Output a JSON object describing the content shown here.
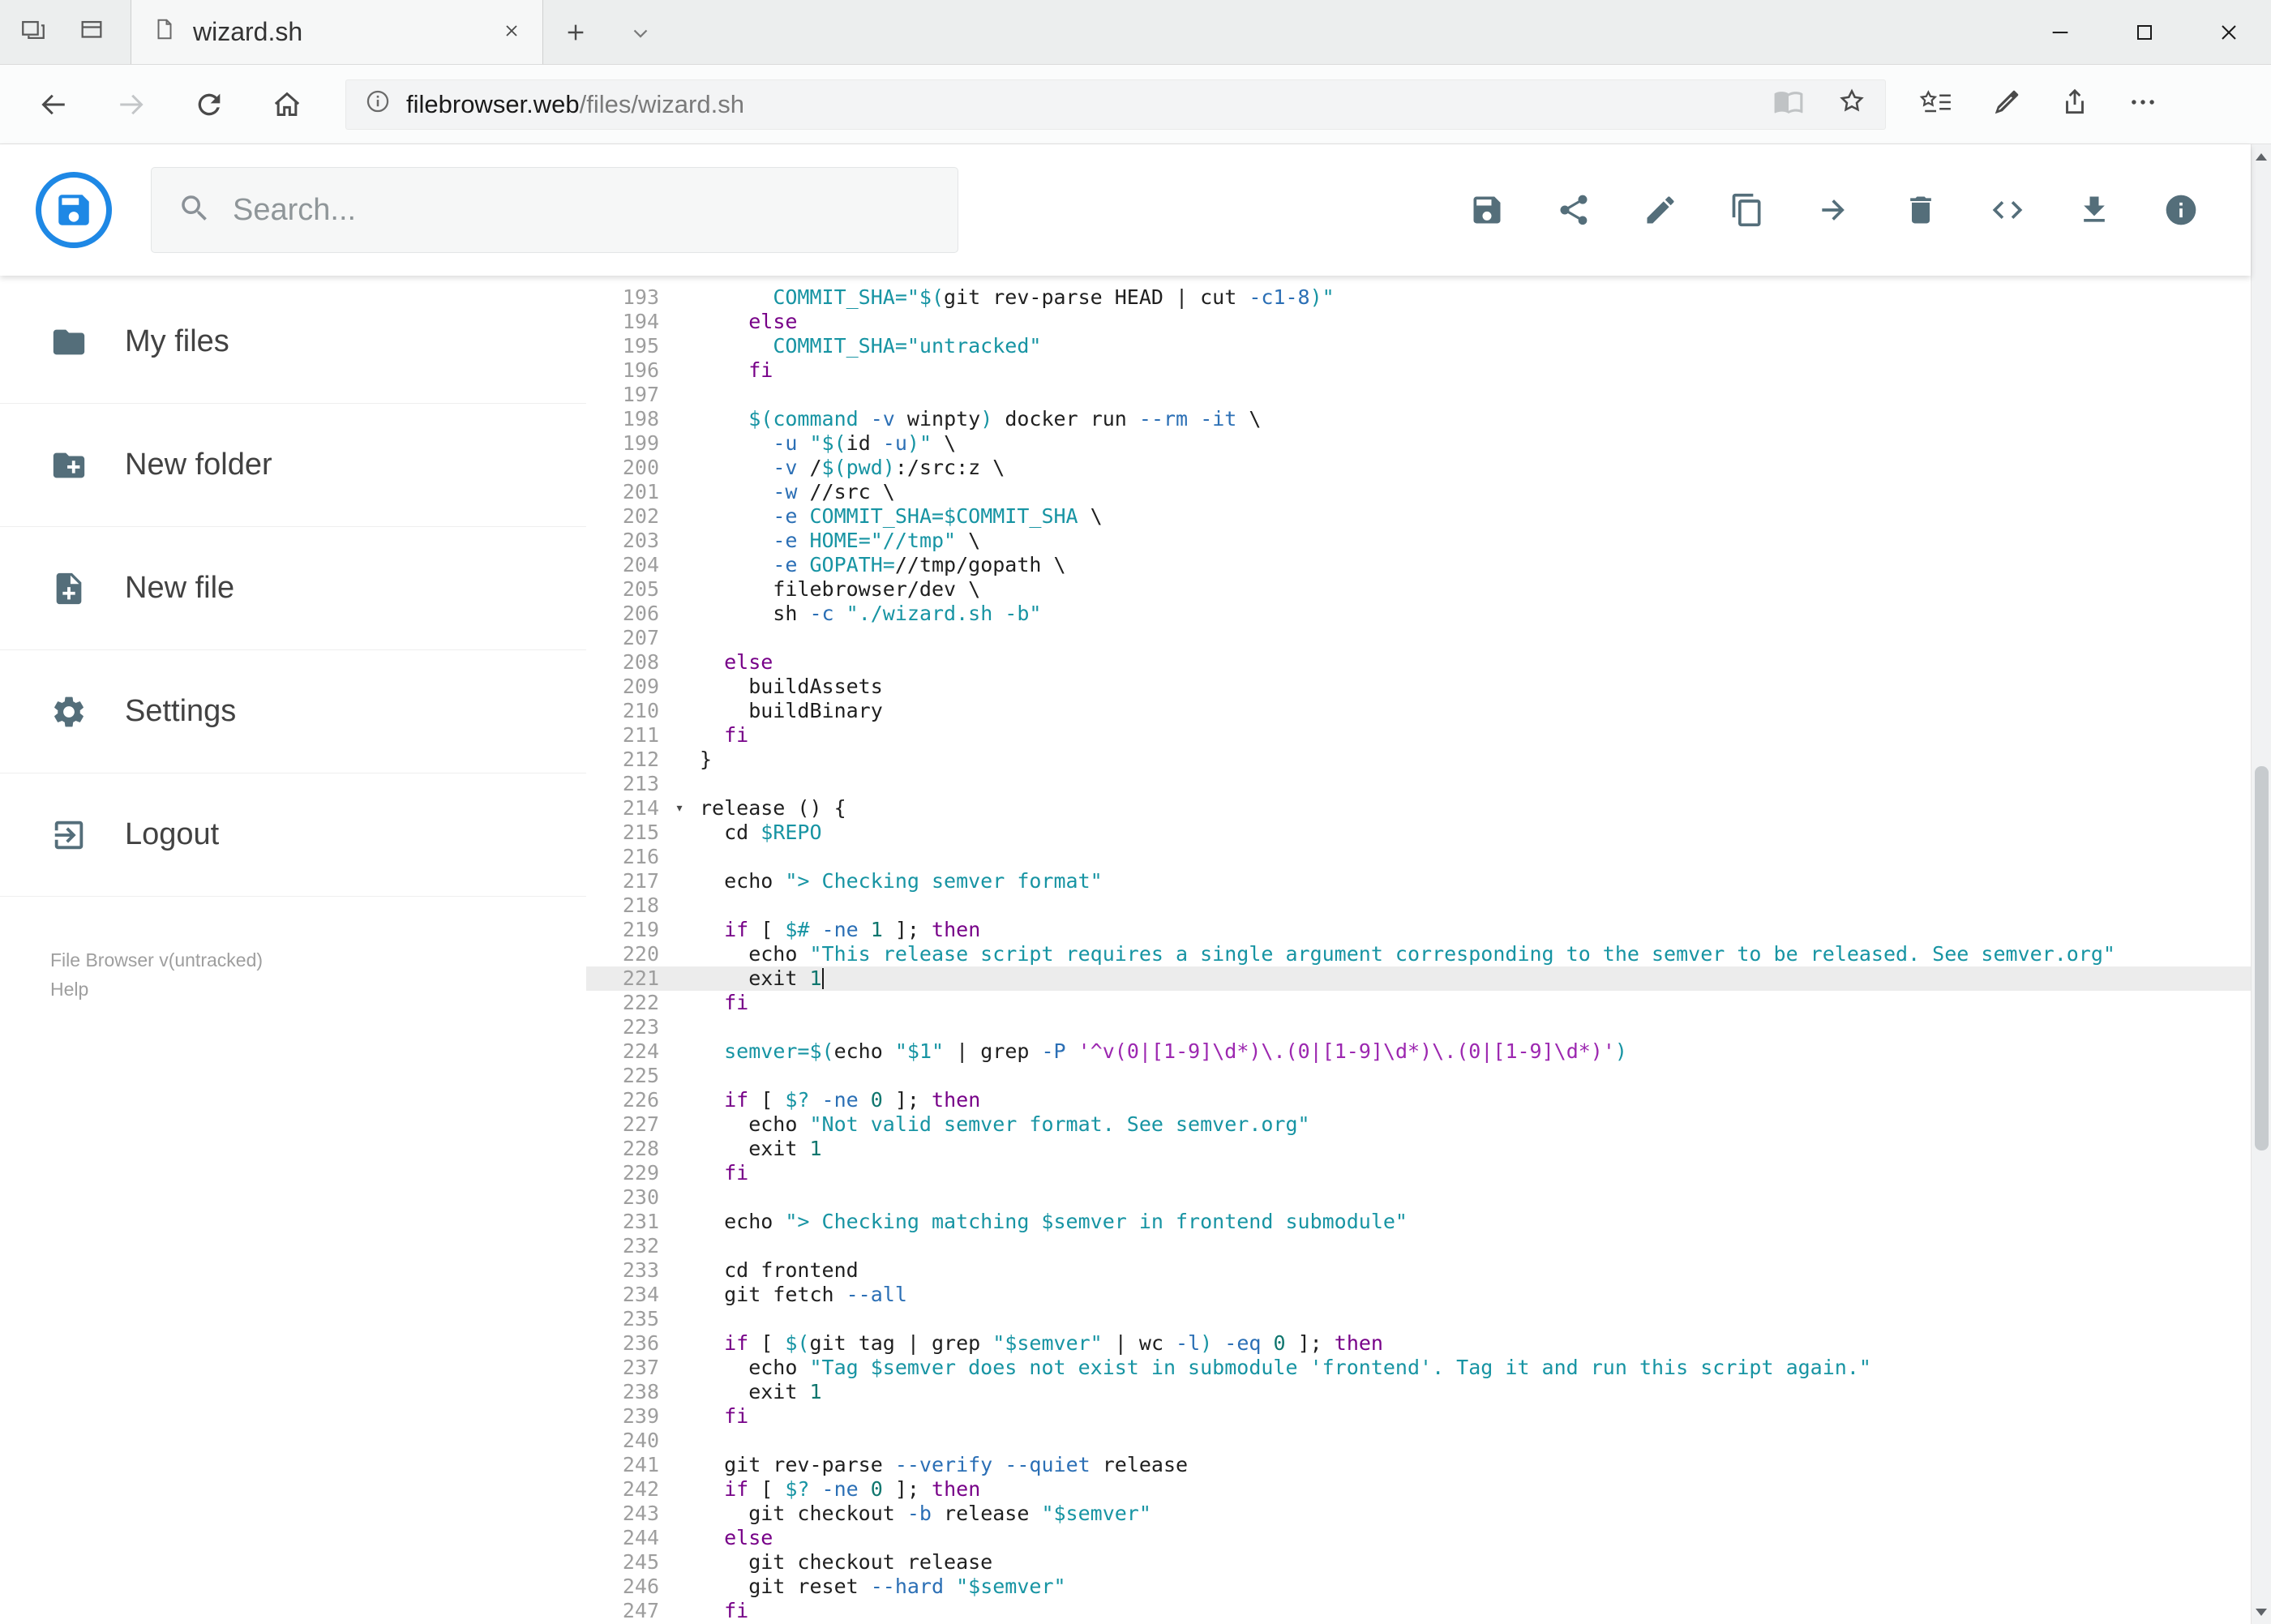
{
  "browser": {
    "tab_title": "wizard.sh",
    "url_host": "filebrowser.web",
    "url_path": "/files/wizard.sh"
  },
  "app": {
    "search_placeholder": "Search...",
    "toolbar_icons": [
      "save",
      "share",
      "edit",
      "copy",
      "move",
      "delete",
      "raw-code",
      "download",
      "info"
    ],
    "sidebar": {
      "items": [
        {
          "icon": "folder-icon",
          "label": "My files"
        },
        {
          "icon": "new-folder-icon",
          "label": "New folder"
        },
        {
          "icon": "new-file-icon",
          "label": "New file"
        },
        {
          "icon": "settings-gear-icon",
          "label": "Settings"
        },
        {
          "icon": "logout-icon",
          "label": "Logout"
        }
      ],
      "version_text": "File Browser v(untracked)",
      "help_label": "Help"
    }
  },
  "colors": {
    "accent": "#1e88e5",
    "header_icon": "#546e7a",
    "line_number": "#9e9e9e",
    "active_line_bg": "#ececec",
    "syntax": {
      "keyword": "#770088",
      "teal": "#1794a3",
      "flag": "#2b6fb5",
      "number": "#0f766e",
      "regex": "#9c27b0",
      "plain": "#1f1f1f"
    }
  },
  "editor": {
    "active_line": 221,
    "cursor_line": 221,
    "fold_lines": [
      214
    ],
    "lines": [
      {
        "n": 193,
        "t": [
          [
            "p",
            "      "
          ],
          [
            "t",
            "COMMIT_SHA=\"$("
          ],
          [
            "p",
            "git rev-parse HEAD | cut "
          ],
          [
            "f",
            "-c1-8"
          ],
          [
            "t",
            ")\""
          ]
        ]
      },
      {
        "n": 194,
        "t": [
          [
            "p",
            "    "
          ],
          [
            "k",
            "else"
          ]
        ]
      },
      {
        "n": 195,
        "t": [
          [
            "p",
            "      "
          ],
          [
            "t",
            "COMMIT_SHA=\"untracked\""
          ]
        ]
      },
      {
        "n": 196,
        "t": [
          [
            "p",
            "    "
          ],
          [
            "k",
            "fi"
          ]
        ]
      },
      {
        "n": 197,
        "t": []
      },
      {
        "n": 198,
        "t": [
          [
            "p",
            "    "
          ],
          [
            "t",
            "$(command"
          ],
          [
            "p",
            " "
          ],
          [
            "f",
            "-v"
          ],
          [
            "p",
            " winpty"
          ],
          [
            "t",
            ")"
          ],
          [
            "p",
            " docker run "
          ],
          [
            "f",
            "--rm"
          ],
          [
            "p",
            " "
          ],
          [
            "f",
            "-it"
          ],
          [
            "p",
            " \\"
          ]
        ]
      },
      {
        "n": 199,
        "t": [
          [
            "p",
            "      "
          ],
          [
            "f",
            "-u"
          ],
          [
            "p",
            " "
          ],
          [
            "t",
            "\"$("
          ],
          [
            "p",
            "id "
          ],
          [
            "f",
            "-u"
          ],
          [
            "t",
            ")\""
          ],
          [
            "p",
            " \\"
          ]
        ]
      },
      {
        "n": 200,
        "t": [
          [
            "p",
            "      "
          ],
          [
            "f",
            "-v"
          ],
          [
            "p",
            " /"
          ],
          [
            "t",
            "$(pwd)"
          ],
          [
            "p",
            ":/src:z \\"
          ]
        ]
      },
      {
        "n": 201,
        "t": [
          [
            "p",
            "      "
          ],
          [
            "f",
            "-w"
          ],
          [
            "p",
            " //src \\"
          ]
        ]
      },
      {
        "n": 202,
        "t": [
          [
            "p",
            "      "
          ],
          [
            "f",
            "-e"
          ],
          [
            "p",
            " "
          ],
          [
            "t",
            "COMMIT_SHA=$COMMIT_SHA"
          ],
          [
            "p",
            " \\"
          ]
        ]
      },
      {
        "n": 203,
        "t": [
          [
            "p",
            "      "
          ],
          [
            "f",
            "-e"
          ],
          [
            "p",
            " "
          ],
          [
            "t",
            "HOME=\"//tmp\""
          ],
          [
            "p",
            " \\"
          ]
        ]
      },
      {
        "n": 204,
        "t": [
          [
            "p",
            "      "
          ],
          [
            "f",
            "-e"
          ],
          [
            "p",
            " "
          ],
          [
            "t",
            "GOPATH="
          ],
          [
            "p",
            "//tmp/gopath \\"
          ]
        ]
      },
      {
        "n": 205,
        "t": [
          [
            "p",
            "      filebrowser/dev \\"
          ]
        ]
      },
      {
        "n": 206,
        "t": [
          [
            "p",
            "      sh "
          ],
          [
            "f",
            "-c"
          ],
          [
            "p",
            " "
          ],
          [
            "t",
            "\"./wizard.sh -b\""
          ]
        ]
      },
      {
        "n": 207,
        "t": []
      },
      {
        "n": 208,
        "t": [
          [
            "p",
            "  "
          ],
          [
            "k",
            "else"
          ]
        ]
      },
      {
        "n": 209,
        "t": [
          [
            "p",
            "    buildAssets"
          ]
        ]
      },
      {
        "n": 210,
        "t": [
          [
            "p",
            "    buildBinary"
          ]
        ]
      },
      {
        "n": 211,
        "t": [
          [
            "p",
            "  "
          ],
          [
            "k",
            "fi"
          ]
        ]
      },
      {
        "n": 212,
        "t": [
          [
            "p",
            "}"
          ]
        ]
      },
      {
        "n": 213,
        "t": []
      },
      {
        "n": 214,
        "t": [
          [
            "p",
            "release () {"
          ]
        ]
      },
      {
        "n": 215,
        "t": [
          [
            "p",
            "  cd "
          ],
          [
            "t",
            "$REPO"
          ]
        ]
      },
      {
        "n": 216,
        "t": []
      },
      {
        "n": 217,
        "t": [
          [
            "p",
            "  echo "
          ],
          [
            "t",
            "\"> Checking semver format\""
          ]
        ]
      },
      {
        "n": 218,
        "t": []
      },
      {
        "n": 219,
        "t": [
          [
            "p",
            "  "
          ],
          [
            "k",
            "if"
          ],
          [
            "p",
            " [ "
          ],
          [
            "t",
            "$#"
          ],
          [
            "p",
            " "
          ],
          [
            "f",
            "-ne"
          ],
          [
            "p",
            " "
          ],
          [
            "n",
            "1"
          ],
          [
            "p",
            " ]; "
          ],
          [
            "k",
            "then"
          ]
        ]
      },
      {
        "n": 220,
        "t": [
          [
            "p",
            "    echo "
          ],
          [
            "t",
            "\"This release script requires a single argument corresponding to the semver to be released. See semver.org\""
          ]
        ]
      },
      {
        "n": 221,
        "t": [
          [
            "p",
            "    exit "
          ],
          [
            "n",
            "1"
          ]
        ]
      },
      {
        "n": 222,
        "t": [
          [
            "p",
            "  "
          ],
          [
            "k",
            "fi"
          ]
        ]
      },
      {
        "n": 223,
        "t": []
      },
      {
        "n": 224,
        "t": [
          [
            "p",
            "  "
          ],
          [
            "t",
            "semver=$("
          ],
          [
            "p",
            "echo "
          ],
          [
            "t",
            "\"$1\""
          ],
          [
            "p",
            " | grep "
          ],
          [
            "f",
            "-P"
          ],
          [
            "p",
            " "
          ],
          [
            "r",
            "'^v(0|[1-9]\\d*)\\.(0|[1-9]\\d*)\\.(0|[1-9]\\d*)'"
          ],
          [
            "t",
            ")"
          ]
        ]
      },
      {
        "n": 225,
        "t": []
      },
      {
        "n": 226,
        "t": [
          [
            "p",
            "  "
          ],
          [
            "k",
            "if"
          ],
          [
            "p",
            " [ "
          ],
          [
            "t",
            "$?"
          ],
          [
            "p",
            " "
          ],
          [
            "f",
            "-ne"
          ],
          [
            "p",
            " "
          ],
          [
            "n",
            "0"
          ],
          [
            "p",
            " ]; "
          ],
          [
            "k",
            "then"
          ]
        ]
      },
      {
        "n": 227,
        "t": [
          [
            "p",
            "    echo "
          ],
          [
            "t",
            "\"Not valid semver format. See semver.org\""
          ]
        ]
      },
      {
        "n": 228,
        "t": [
          [
            "p",
            "    exit "
          ],
          [
            "n",
            "1"
          ]
        ]
      },
      {
        "n": 229,
        "t": [
          [
            "p",
            "  "
          ],
          [
            "k",
            "fi"
          ]
        ]
      },
      {
        "n": 230,
        "t": []
      },
      {
        "n": 231,
        "t": [
          [
            "p",
            "  echo "
          ],
          [
            "t",
            "\"> Checking matching $semver in frontend submodule\""
          ]
        ]
      },
      {
        "n": 232,
        "t": []
      },
      {
        "n": 233,
        "t": [
          [
            "p",
            "  cd frontend"
          ]
        ]
      },
      {
        "n": 234,
        "t": [
          [
            "p",
            "  git fetch "
          ],
          [
            "f",
            "--all"
          ]
        ]
      },
      {
        "n": 235,
        "t": []
      },
      {
        "n": 236,
        "t": [
          [
            "p",
            "  "
          ],
          [
            "k",
            "if"
          ],
          [
            "p",
            " [ "
          ],
          [
            "t",
            "$("
          ],
          [
            "p",
            "git tag | grep "
          ],
          [
            "t",
            "\"$semver\""
          ],
          [
            "p",
            " | wc "
          ],
          [
            "f",
            "-l"
          ],
          [
            "t",
            ")"
          ],
          [
            "p",
            " "
          ],
          [
            "f",
            "-eq"
          ],
          [
            "p",
            " "
          ],
          [
            "n",
            "0"
          ],
          [
            "p",
            " ]; "
          ],
          [
            "k",
            "then"
          ]
        ]
      },
      {
        "n": 237,
        "t": [
          [
            "p",
            "    echo "
          ],
          [
            "t",
            "\"Tag $semver does not exist in submodule 'frontend'. Tag it and run this script again.\""
          ]
        ]
      },
      {
        "n": 238,
        "t": [
          [
            "p",
            "    exit "
          ],
          [
            "n",
            "1"
          ]
        ]
      },
      {
        "n": 239,
        "t": [
          [
            "p",
            "  "
          ],
          [
            "k",
            "fi"
          ]
        ]
      },
      {
        "n": 240,
        "t": []
      },
      {
        "n": 241,
        "t": [
          [
            "p",
            "  git rev-parse "
          ],
          [
            "f",
            "--verify"
          ],
          [
            "p",
            " "
          ],
          [
            "f",
            "--quiet"
          ],
          [
            "p",
            " release"
          ]
        ]
      },
      {
        "n": 242,
        "t": [
          [
            "p",
            "  "
          ],
          [
            "k",
            "if"
          ],
          [
            "p",
            " [ "
          ],
          [
            "t",
            "$?"
          ],
          [
            "p",
            " "
          ],
          [
            "f",
            "-ne"
          ],
          [
            "p",
            " "
          ],
          [
            "n",
            "0"
          ],
          [
            "p",
            " ]; "
          ],
          [
            "k",
            "then"
          ]
        ]
      },
      {
        "n": 243,
        "t": [
          [
            "p",
            "    git checkout "
          ],
          [
            "f",
            "-b"
          ],
          [
            "p",
            " release "
          ],
          [
            "t",
            "\"$semver\""
          ]
        ]
      },
      {
        "n": 244,
        "t": [
          [
            "p",
            "  "
          ],
          [
            "k",
            "else"
          ]
        ]
      },
      {
        "n": 245,
        "t": [
          [
            "p",
            "    git checkout release"
          ]
        ]
      },
      {
        "n": 246,
        "t": [
          [
            "p",
            "    git reset "
          ],
          [
            "f",
            "--hard"
          ],
          [
            "p",
            " "
          ],
          [
            "t",
            "\"$semver\""
          ]
        ]
      },
      {
        "n": 247,
        "t": [
          [
            "p",
            "  "
          ],
          [
            "k",
            "fi"
          ]
        ]
      }
    ]
  }
}
